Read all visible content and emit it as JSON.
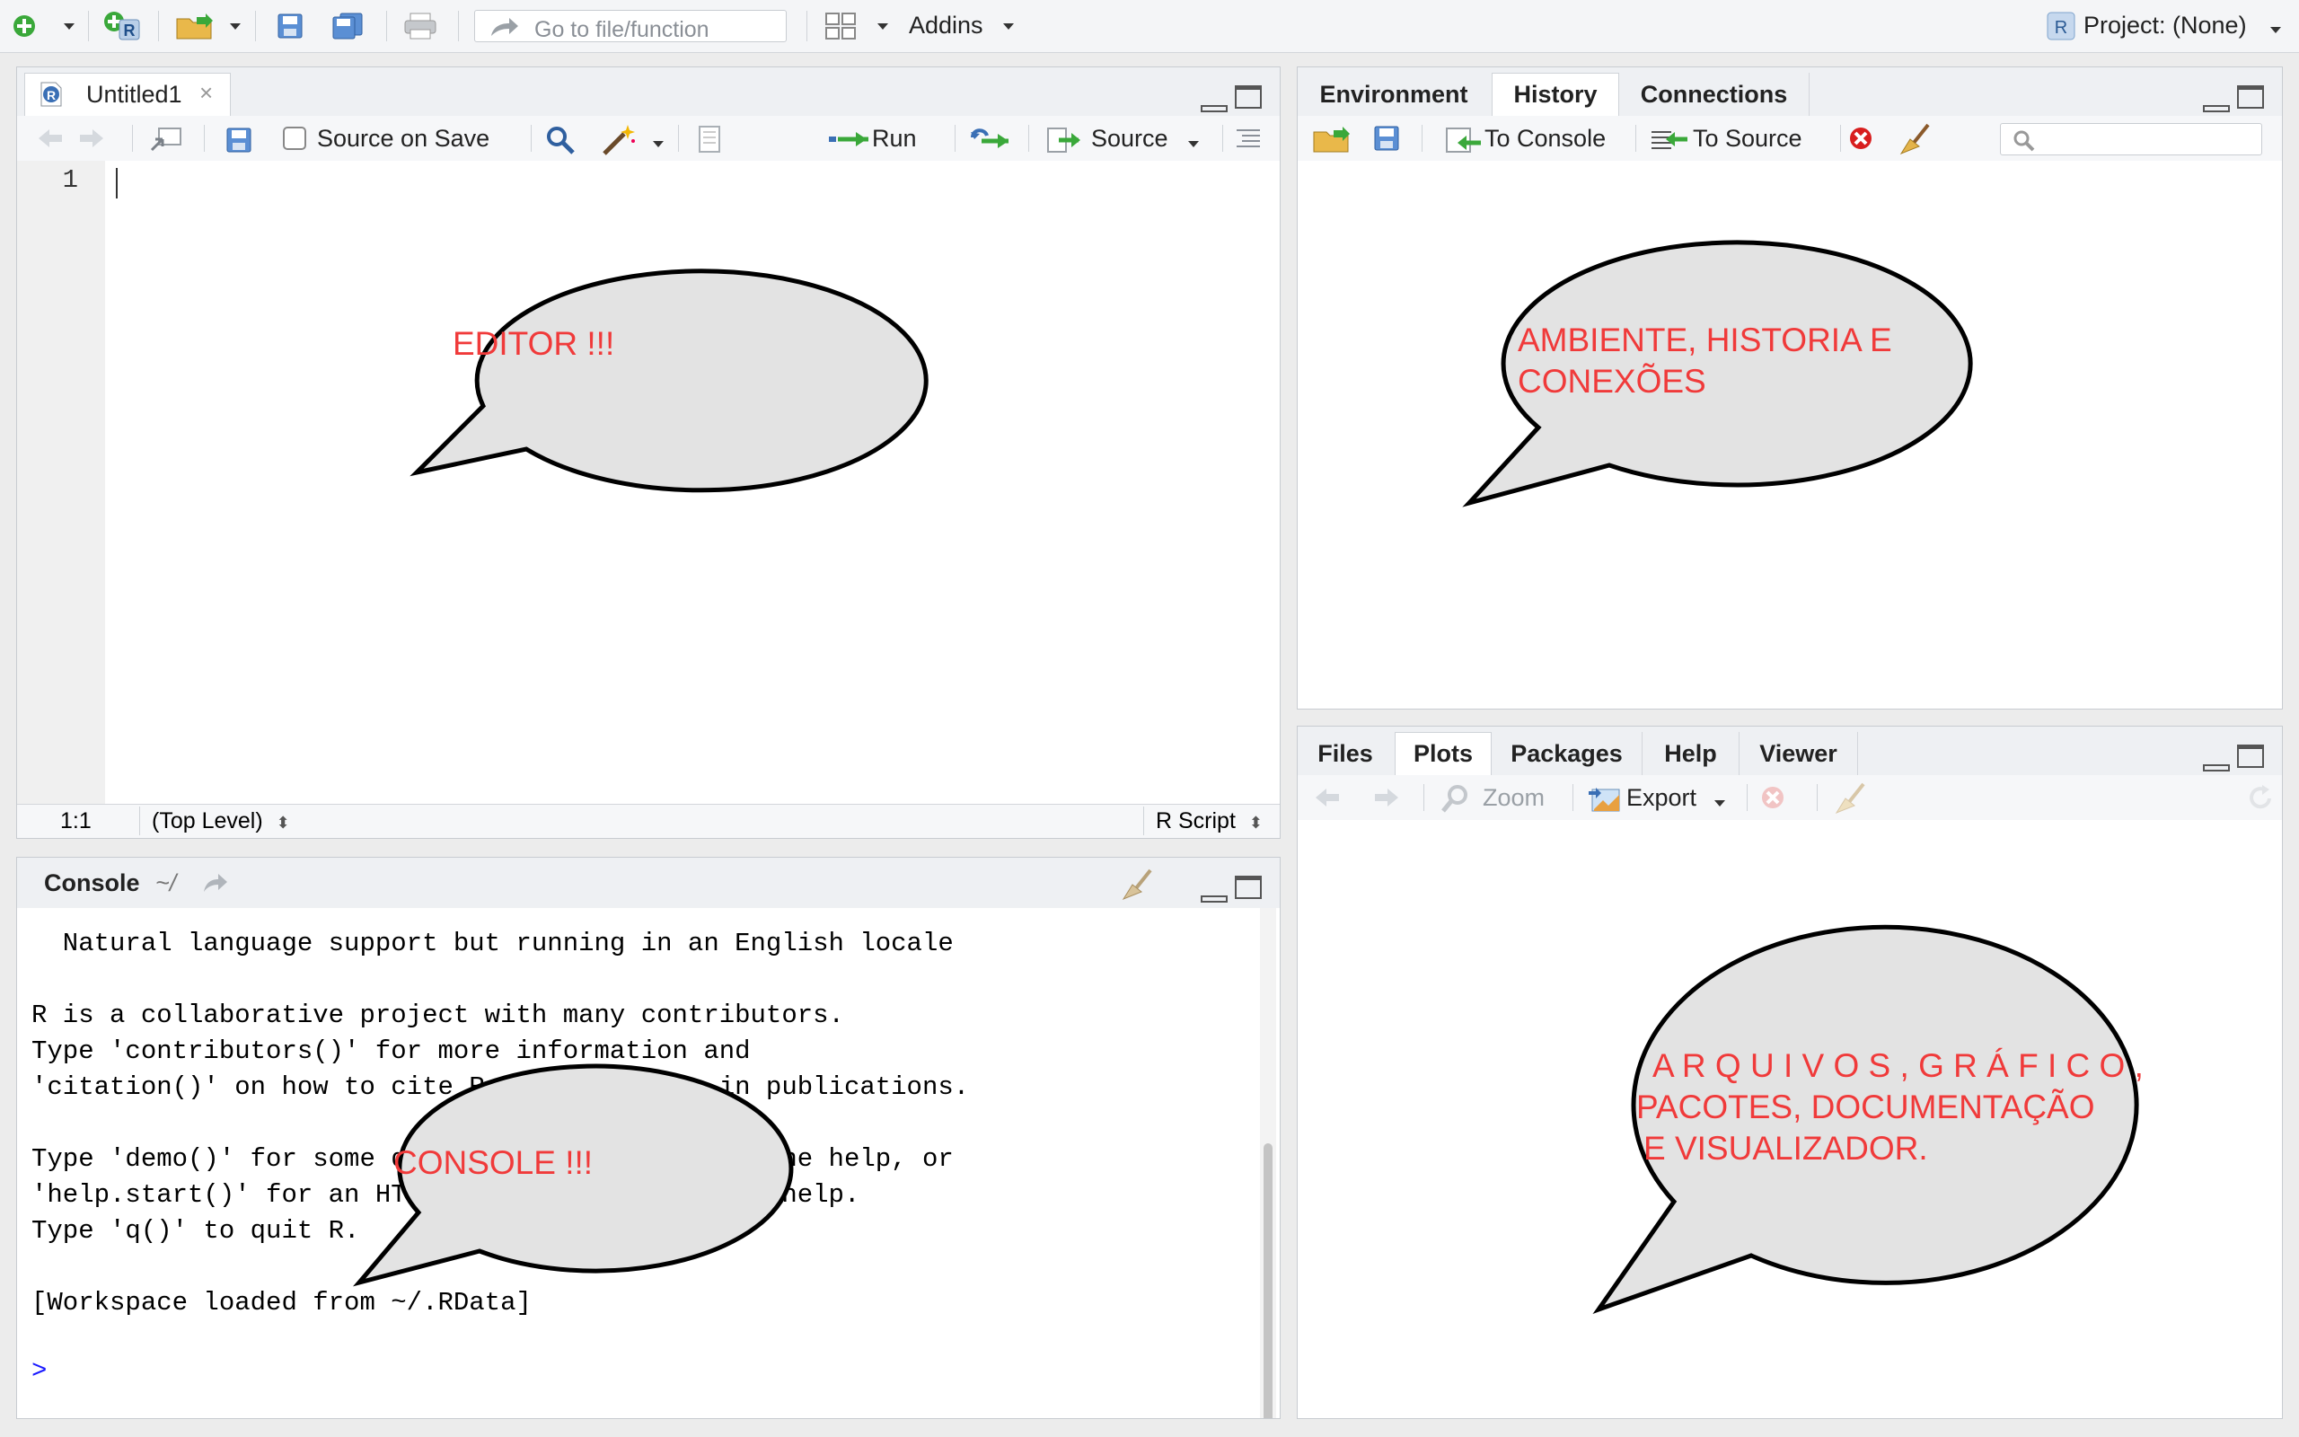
{
  "toolbar": {
    "goto_placeholder": "Go to file/function",
    "addins_label": "Addins",
    "project_label": "Project: (None)"
  },
  "source_pane": {
    "tab_label": "Untitled1",
    "source_on_save_label": "Source on Save",
    "run_label": "Run",
    "source_label": "Source",
    "line_number": "1",
    "cursor_pos": "1:1",
    "scope_label": "(Top Level)",
    "file_type": "R Script",
    "callout": "EDITOR !!!"
  },
  "env_pane": {
    "tabs": [
      "Environment",
      "History",
      "Connections"
    ],
    "active_tab": "History",
    "to_console_label": "To Console",
    "to_source_label": "To Source",
    "callout_lines": [
      "AMBIENTE, HISTORIA E",
      "CONEXÕES"
    ]
  },
  "console_pane": {
    "title": "Console",
    "path": "~/",
    "lines": [
      "  Natural language support but running in an English locale",
      "",
      "R is a collaborative project with many contributors.",
      "Type 'contributors()' for more information and",
      "'citation()' on how to cite R or R packages in publications.",
      "",
      "Type 'demo()' for some demos, 'help()' for on-line help, or",
      "'help.start()' for an HTML browser interface to help.",
      "Type 'q()' to quit R.",
      "",
      "[Workspace loaded from ~/.RData]"
    ],
    "prompt": ">",
    "callout": "CONSOLE !!!"
  },
  "files_pane": {
    "tabs": [
      "Files",
      "Plots",
      "Packages",
      "Help",
      "Viewer"
    ],
    "active_tab": "Plots",
    "zoom_label": "Zoom",
    "export_label": "Export",
    "callout_lines": [
      "A R Q U I V O S ,   G R Á F I C O ,",
      "PACOTES,  DOCUMENTAÇÃO",
      " E VISUALIZADOR."
    ]
  },
  "colors": {
    "callout_text": "#f03a3a",
    "bubble_fill": "#e3e3e3",
    "prompt": "#1a1aff"
  }
}
